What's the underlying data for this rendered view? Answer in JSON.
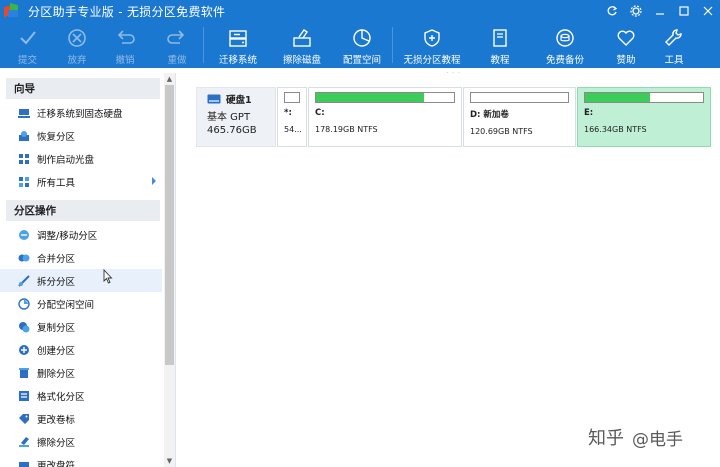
{
  "window": {
    "title": "分区助手专业版 - 无损分区免费软件",
    "controls": [
      "refresh-icon",
      "gear-icon",
      "minimize-icon",
      "maximize-icon",
      "close-icon"
    ]
  },
  "toolbar": {
    "items": [
      {
        "label": "提交",
        "icon": "check-icon",
        "enabled": false
      },
      {
        "label": "放弃",
        "icon": "discard-icon",
        "enabled": false
      },
      {
        "label": "撤销",
        "icon": "undo-icon",
        "enabled": false
      },
      {
        "label": "重做",
        "icon": "redo-icon",
        "enabled": false
      },
      {
        "label": "迁移系统",
        "icon": "migrate-system-icon",
        "enabled": true
      },
      {
        "label": "擦除磁盘",
        "icon": "wipe-disk-icon",
        "enabled": true
      },
      {
        "label": "配置空间",
        "icon": "allocate-space-icon",
        "enabled": true
      },
      {
        "label": "无损分区教程",
        "icon": "shield-icon",
        "enabled": true
      },
      {
        "label": "教程",
        "icon": "book-icon",
        "enabled": true
      },
      {
        "label": "免费备份",
        "icon": "backup-icon",
        "enabled": true
      },
      {
        "label": "赞助",
        "icon": "heart-icon",
        "enabled": true
      },
      {
        "label": "工具",
        "icon": "wrench-icon",
        "enabled": true
      }
    ]
  },
  "sidebar": {
    "wizard_title": "向导",
    "wizard_items": [
      {
        "label": "迁移系统到固态硬盘",
        "icon": "migrate-ssd-icon"
      },
      {
        "label": "恢复分区",
        "icon": "recover-partition-icon"
      },
      {
        "label": "制作启动光盘",
        "icon": "boot-disc-icon"
      },
      {
        "label": "所有工具",
        "icon": "all-tools-icon"
      }
    ],
    "ops_title": "分区操作",
    "ops_items": [
      {
        "label": "调整/移动分区",
        "icon": "resize-move-icon"
      },
      {
        "label": "合并分区",
        "icon": "merge-icon"
      },
      {
        "label": "拆分分区",
        "icon": "split-icon"
      },
      {
        "label": "分配空闲空间",
        "icon": "allocate-free-icon"
      },
      {
        "label": "复制分区",
        "icon": "copy-partition-icon"
      },
      {
        "label": "创建分区",
        "icon": "create-partition-icon"
      },
      {
        "label": "删除分区",
        "icon": "delete-partition-icon"
      },
      {
        "label": "格式化分区",
        "icon": "format-icon"
      },
      {
        "label": "更改卷标",
        "icon": "label-icon"
      },
      {
        "label": "擦除分区",
        "icon": "wipe-partition-icon"
      },
      {
        "label": "更改盘符",
        "icon": "drive-letter-icon"
      }
    ]
  },
  "disk": {
    "name": "硬盘1",
    "type": "基本 GPT",
    "size": "465.76GB",
    "partitions": [
      {
        "name": "*:",
        "info": "54...",
        "used_fraction": 0.0,
        "selected": false
      },
      {
        "name": "C:",
        "info": "178.19GB NTFS",
        "used_fraction": 0.78,
        "selected": false
      },
      {
        "name": "D: 新加卷",
        "info": "120.69GB NTFS",
        "used_fraction": 0.0,
        "selected": false
      },
      {
        "name": "E:",
        "info": "166.34GB NTFS",
        "used_fraction": 0.55,
        "selected": true
      }
    ]
  },
  "watermark": {
    "logo_text": "知乎",
    "handle": "@电手"
  }
}
